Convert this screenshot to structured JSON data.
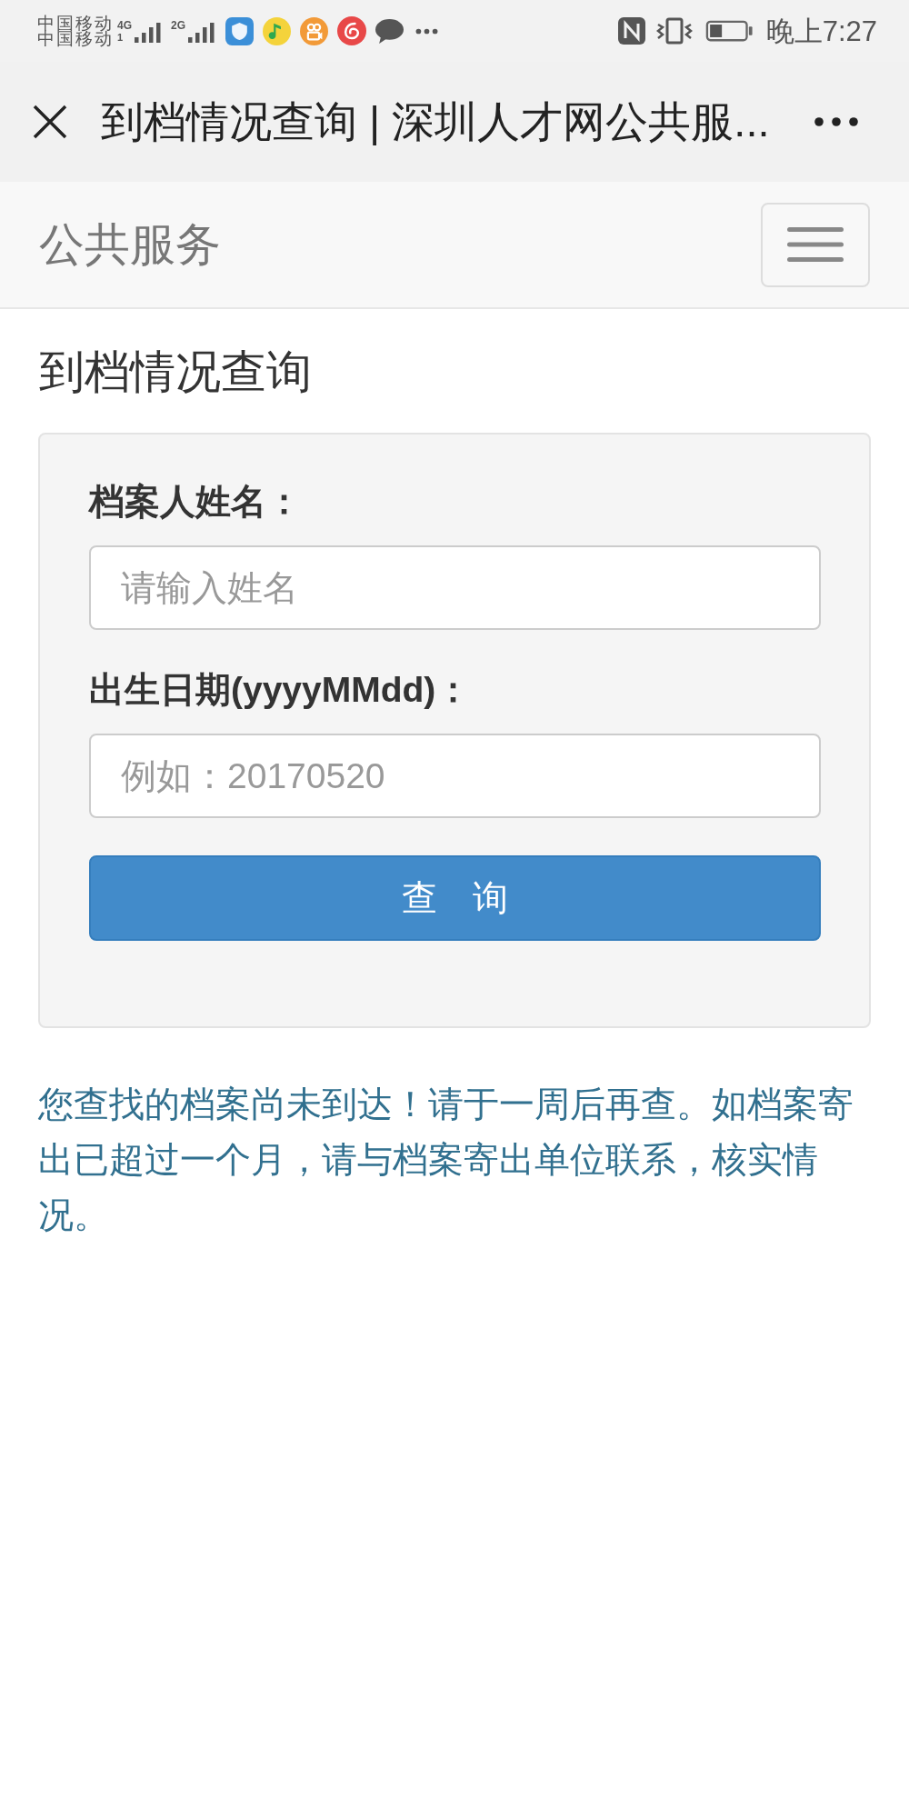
{
  "status_bar": {
    "carriers": [
      "中国移动",
      "中国移动"
    ],
    "networks": [
      {
        "label": "4G",
        "sim": "1"
      },
      {
        "label": "2G"
      }
    ],
    "time": "晚上7:27"
  },
  "title_bar": {
    "title": "到档情况查询 | 深圳人才网公共服..."
  },
  "navbar": {
    "brand": "公共服务"
  },
  "page": {
    "heading": "到档情况查询"
  },
  "form": {
    "fields": [
      {
        "label": "档案人姓名：",
        "placeholder": "请输入姓名"
      },
      {
        "label": "出生日期(yyyyMMdd)：",
        "placeholder": "例如：20170520"
      }
    ],
    "button": "查　询"
  },
  "message": "您查找的档案尚未到达！请于一周后再查。如档案寄出已超过一个月，请与档案寄出单位联系，核实情况。"
}
